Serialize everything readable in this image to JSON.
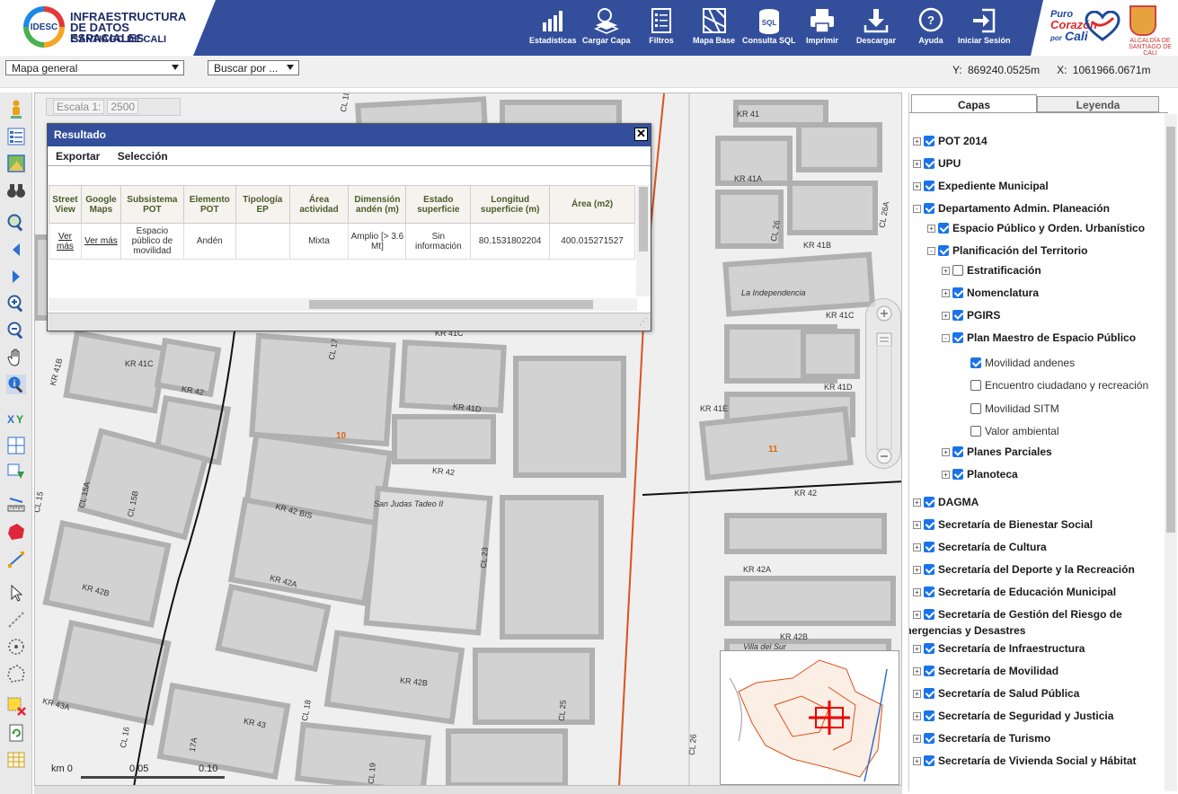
{
  "header": {
    "logo_abbr": "IDESC",
    "logo_line1": "INFRAESTRUCTURA DE DATOS ESPACIALES",
    "logo_line2": "SANTIAGO DE CALI",
    "tools": [
      {
        "label": "Estadísticas",
        "icon": "chart-icon"
      },
      {
        "label": "Cargar Capa",
        "icon": "load-layer-icon"
      },
      {
        "label": "Filtros",
        "icon": "filter-icon"
      },
      {
        "label": "Mapa Base",
        "icon": "basemap-icon"
      },
      {
        "label": "Consulta SQL",
        "icon": "sql-icon"
      },
      {
        "label": "Imprimir",
        "icon": "printer-icon"
      },
      {
        "label": "Descargar",
        "icon": "download-icon"
      },
      {
        "label": "Ayuda",
        "icon": "help-icon"
      },
      {
        "label": "Iniciar Sesión",
        "icon": "login-icon"
      }
    ],
    "brand_puro": "Puro",
    "brand_corazon": "Corazón",
    "brand_por": "por",
    "brand_cali": "Cali",
    "alcaldia": "ALCALDÍA DE SANTIAGO DE CALI"
  },
  "subbar": {
    "map_select": "Mapa general",
    "search_select": "Buscar por ...",
    "coord_y": "Y: 869240.0525m",
    "coord_x": "X: 1061966.0671m"
  },
  "map": {
    "escala_label": "Escala 1:",
    "escala_value": "2500",
    "scale_labels": [
      "km 0",
      "0.05",
      "0.10"
    ],
    "streets": [
      "KR 41",
      "KR 41A",
      "CL 26",
      "CL 26A",
      "KR 41B",
      "KR 41C",
      "KR 41D",
      "KR 41E",
      "KR 42",
      "KR 42",
      "KR 42",
      "KR 42A",
      "KR 42A",
      "KR 42B",
      "KR 42B",
      "KR 42B",
      "KR 42 BIS",
      "KR 43",
      "KR 43A",
      "KR 41B",
      "KR 41C",
      "KR 41D",
      "KR 41C",
      "CL 17",
      "CL 15",
      "CL 15A",
      "CL 15B",
      "CL 18",
      "CL 19",
      "CL 23",
      "CL 25",
      "CL 26",
      "CL 16",
      "17A",
      "CL 18"
    ],
    "places": [
      "La Independencia",
      "San Judas Tadeo II",
      "Villa del Sur"
    ],
    "zones": [
      "10",
      "11"
    ]
  },
  "popup": {
    "title": "Resultado",
    "menu": [
      "Exportar",
      "Selección"
    ],
    "columns": [
      "Street View",
      "Google Maps",
      "Subsistema POT",
      "Elemento POT",
      "Tipología EP",
      "Área actividad",
      "Dimensión andén (m)",
      "Estado superficie",
      "Longitud superficie (m)",
      "Área (m2)"
    ],
    "row": [
      "Ver más",
      "Ver más",
      "Espacio público de movilidad",
      "Andén",
      "",
      "Mixta",
      "Amplio [> 3.6 Mt]",
      "Sin información",
      "80.1531802204",
      "400.015271527"
    ]
  },
  "panel": {
    "tab_capas": "Capas",
    "tab_leyenda": "Leyenda",
    "layers": [
      {
        "label": "POT 2014",
        "level": 0,
        "checked": true,
        "expander": "+",
        "bold": true
      },
      {
        "label": "UPU",
        "level": 0,
        "checked": true,
        "expander": "+",
        "bold": true
      },
      {
        "label": "Expediente Municipal",
        "level": 0,
        "checked": true,
        "expander": "+",
        "bold": true
      },
      {
        "label": "Departamento Admin. Planeación",
        "level": 0,
        "checked": true,
        "expander": "-",
        "bold": true
      },
      {
        "label": "Espacio Público y Orden. Urbanístico",
        "level": 1,
        "checked": true,
        "expander": "+",
        "bold": true
      },
      {
        "label": "Planificación del Territorio",
        "level": 1,
        "checked": true,
        "expander": "-",
        "bold": true
      },
      {
        "label": "Estratificación",
        "level": 2,
        "checked": false,
        "expander": "+",
        "bold": true
      },
      {
        "label": "Nomenclatura",
        "level": 2,
        "checked": true,
        "expander": "+",
        "bold": true
      },
      {
        "label": "PGIRS",
        "level": 2,
        "checked": true,
        "expander": "+",
        "bold": true
      },
      {
        "label": "Plan Maestro de Espacio Público",
        "level": 2,
        "checked": true,
        "expander": "-",
        "bold": true
      },
      {
        "label": "Movilidad andenes",
        "level": 3,
        "checked": true,
        "expander": "",
        "bold": false
      },
      {
        "label": "Encuentro ciudadano y recreación",
        "level": 3,
        "checked": false,
        "expander": "",
        "bold": false
      },
      {
        "label": "Movilidad SITM",
        "level": 3,
        "checked": false,
        "expander": "",
        "bold": false
      },
      {
        "label": "Valor ambiental",
        "level": 3,
        "checked": false,
        "expander": "",
        "bold": false
      },
      {
        "label": "Planes Parciales",
        "level": 2,
        "checked": true,
        "expander": "+",
        "bold": true
      },
      {
        "label": "Planoteca",
        "level": 2,
        "checked": true,
        "expander": "+",
        "bold": true
      },
      {
        "label": "DAGMA",
        "level": 0,
        "checked": true,
        "expander": "+",
        "bold": true
      },
      {
        "label": "Secretaría de Bienestar Social",
        "level": 0,
        "checked": true,
        "expander": "+",
        "bold": true
      },
      {
        "label": "Secretaría de Cultura",
        "level": 0,
        "checked": true,
        "expander": "+",
        "bold": true
      },
      {
        "label": "Secretaría del Deporte y la Recreación",
        "level": 0,
        "checked": true,
        "expander": "+",
        "bold": true
      },
      {
        "label": "Secretaría de Educación Municipal",
        "level": 0,
        "checked": true,
        "expander": "+",
        "bold": true
      },
      {
        "label": "Secretaría de Gestión del Riesgo de",
        "label2": "Emergencias y Desastres",
        "level": 0,
        "checked": true,
        "expander": "+",
        "bold": true
      },
      {
        "label": "Secretaría de Infraestructura",
        "level": 0,
        "checked": true,
        "expander": "+",
        "bold": true
      },
      {
        "label": "Secretaría de Movilidad",
        "level": 0,
        "checked": true,
        "expander": "+",
        "bold": true
      },
      {
        "label": "Secretaría de Salud Pública",
        "level": 0,
        "checked": true,
        "expander": "+",
        "bold": true
      },
      {
        "label": "Secretaría de Seguridad y Justicia",
        "level": 0,
        "checked": true,
        "expander": "+",
        "bold": true
      },
      {
        "label": "Secretaría de Turismo",
        "level": 0,
        "checked": true,
        "expander": "+",
        "bold": true
      },
      {
        "label": "Secretaría de Vivienda Social y Hábitat",
        "level": 0,
        "checked": true,
        "expander": "+",
        "bold": true
      }
    ]
  },
  "colors": {
    "header_blue": "#334f9c",
    "check_blue": "#1a73e8",
    "block_gray": "#bdbdbd",
    "zone_orange": "#e0660d",
    "river": "#d9531e"
  }
}
